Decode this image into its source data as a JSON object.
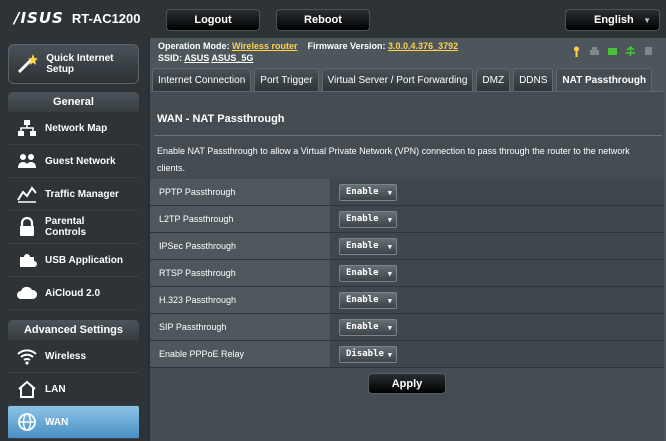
{
  "header": {
    "brand": "/ISUS",
    "model": "RT-AC1200",
    "logout_label": "Logout",
    "reboot_label": "Reboot",
    "language": "English"
  },
  "status": {
    "operation_mode_label": "Operation Mode:",
    "operation_mode_value": "Wireless router",
    "firmware_label": "Firmware Version:",
    "firmware_value": "3.0.0.4.376_3792",
    "ssid_label": "SSID:",
    "ssid_values": [
      "ASUS",
      "ASUS_5G"
    ]
  },
  "sidebar": {
    "quick_setup": "Quick Internet Setup",
    "general_head": "General",
    "general_items": [
      {
        "label": "Network Map",
        "icon": "network-map-icon"
      },
      {
        "label": "Guest Network",
        "icon": "guest-network-icon"
      },
      {
        "label": "Traffic Manager",
        "icon": "traffic-manager-icon"
      },
      {
        "label": "Parental Controls",
        "icon": "lock-icon"
      },
      {
        "label": "USB Application",
        "icon": "puzzle-icon"
      },
      {
        "label": "AiCloud 2.0",
        "icon": "cloud-icon"
      }
    ],
    "advanced_head": "Advanced Settings",
    "advanced_items": [
      {
        "label": "Wireless",
        "icon": "wifi-icon"
      },
      {
        "label": "LAN",
        "icon": "home-icon"
      },
      {
        "label": "WAN",
        "icon": "globe-icon",
        "active": true
      }
    ]
  },
  "tabs": [
    "Internet Connection",
    "Port Trigger",
    "Virtual Server / Port Forwarding",
    "DMZ",
    "DDNS",
    "NAT Passthrough"
  ],
  "active_tab": "NAT Passthrough",
  "panel": {
    "title": "WAN - NAT Passthrough",
    "description": "Enable NAT Passthrough to allow a Virtual Private Network (VPN) connection to pass through the router to the network clients.",
    "settings": [
      {
        "label": "PPTP Passthrough",
        "value": "Enable"
      },
      {
        "label": "L2TP Passthrough",
        "value": "Enable"
      },
      {
        "label": "IPSec Passthrough",
        "value": "Enable"
      },
      {
        "label": "RTSP Passthrough",
        "value": "Enable"
      },
      {
        "label": "H.323 Passthrough",
        "value": "Enable"
      },
      {
        "label": "SIP Passthrough",
        "value": "Enable"
      },
      {
        "label": "Enable PPPoE Relay",
        "value": "Disable"
      }
    ],
    "apply_label": "Apply"
  },
  "colors": {
    "accent_active": "#4a90c4",
    "status_yellow": "#ffd24a",
    "status_green": "#49c23a"
  }
}
